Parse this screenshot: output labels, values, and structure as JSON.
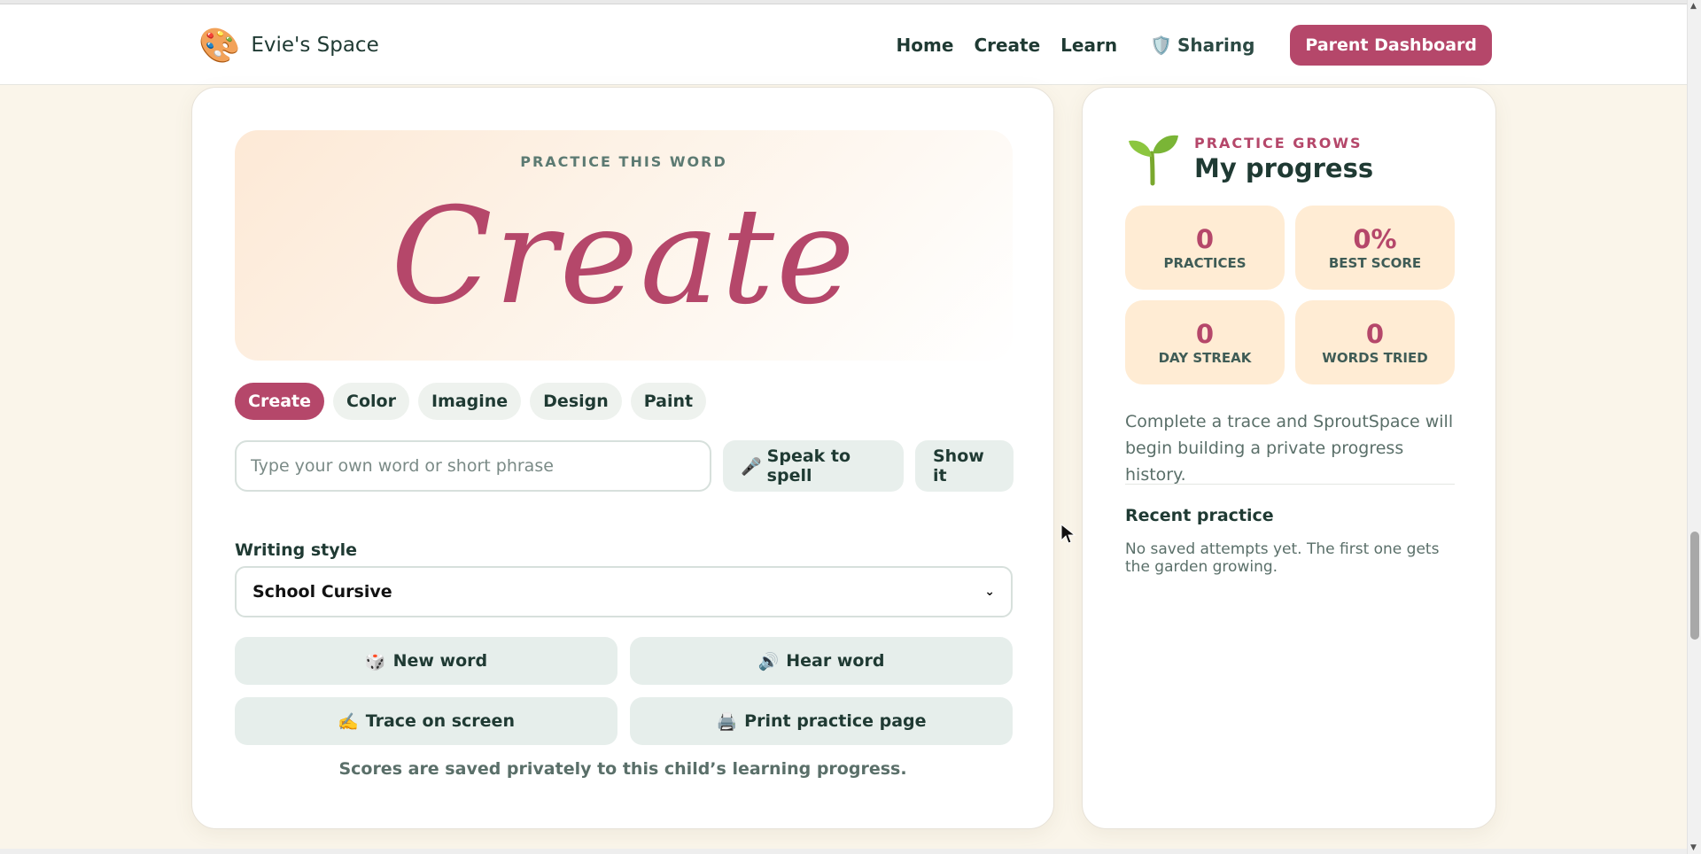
{
  "header": {
    "brand_logo": "🎨",
    "brand_name": "Evie's Space",
    "nav": [
      "Home",
      "Create",
      "Learn"
    ],
    "sharing_icon": "🛡️",
    "sharing_label": "Sharing",
    "parent_button": "Parent Dashboard"
  },
  "practice": {
    "kicker": "PRACTICE THIS WORD",
    "word": "Create",
    "chips": [
      {
        "label": "Create",
        "active": true
      },
      {
        "label": "Color",
        "active": false
      },
      {
        "label": "Imagine",
        "active": false
      },
      {
        "label": "Design",
        "active": false
      },
      {
        "label": "Paint",
        "active": false
      }
    ],
    "input_placeholder": "Type your own word or short phrase",
    "input_value": "",
    "speak_icon": "🎤",
    "speak_label": "Speak to spell",
    "show_label": "Show it",
    "style_label": "Writing style",
    "style_value": "School Cursive",
    "actions": {
      "new_word": {
        "icon": "🎲",
        "label": "New word"
      },
      "hear_word": {
        "icon": "🔊",
        "label": "Hear word"
      },
      "trace": {
        "icon": "✍️",
        "label": "Trace on screen"
      },
      "print": {
        "icon": "🖨️",
        "label": "Print practice page"
      }
    },
    "note": "Scores are saved privately to this child’s learning progress."
  },
  "progress": {
    "kicker": "PRACTICE GROWS",
    "title": "My progress",
    "stats": [
      {
        "value": "0",
        "label": "PRACTICES"
      },
      {
        "value": "0%",
        "label": "BEST SCORE"
      },
      {
        "value": "0",
        "label": "DAY STREAK"
      },
      {
        "value": "0",
        "label": "WORDS TRIED"
      }
    ],
    "description": "Complete a trace and SproutSpace will begin building a private progress history.",
    "recent_title": "Recent practice",
    "recent_empty": "No saved attempts yet. The first one gets the garden growing."
  },
  "colors": {
    "accent": "#b5476a",
    "stat_bg": "#ffecd4",
    "page_bg": "#faf5ea",
    "soft_button": "#e6eeeb"
  }
}
